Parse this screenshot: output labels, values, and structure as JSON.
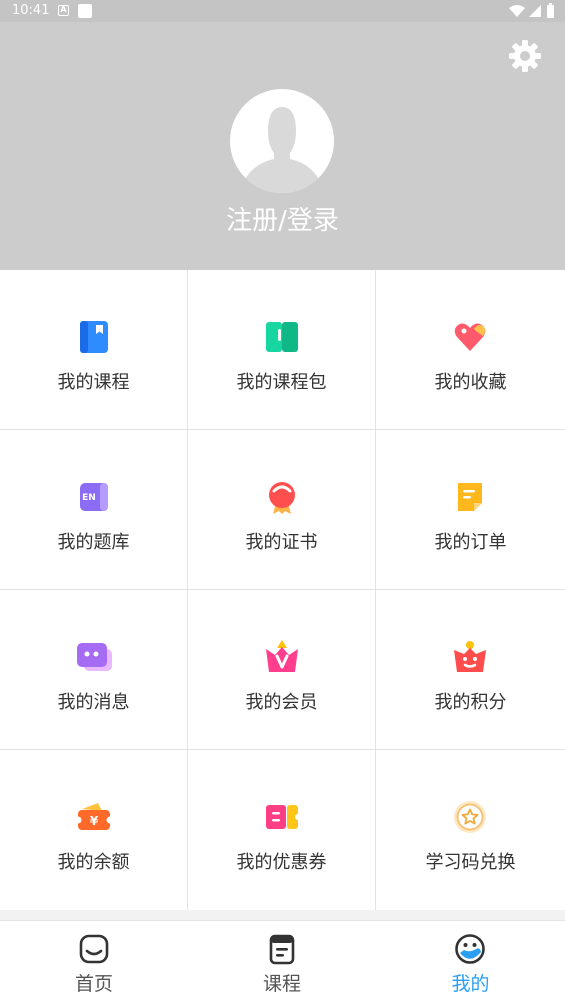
{
  "status_bar": {
    "time": "10:41"
  },
  "profile": {
    "login_label": "注册/登录"
  },
  "menu": [
    {
      "label": "我的课程",
      "icon": "course-book-icon"
    },
    {
      "label": "我的课程包",
      "icon": "course-package-icon"
    },
    {
      "label": "我的收藏",
      "icon": "heart-tag-icon"
    },
    {
      "label": "我的题库",
      "icon": "question-bank-icon"
    },
    {
      "label": "我的证书",
      "icon": "certificate-medal-icon"
    },
    {
      "label": "我的订单",
      "icon": "order-note-icon"
    },
    {
      "label": "我的消息",
      "icon": "message-bubble-icon"
    },
    {
      "label": "我的会员",
      "icon": "vip-crown-icon"
    },
    {
      "label": "我的积分",
      "icon": "points-gift-icon"
    },
    {
      "label": "我的余额",
      "icon": "balance-wallet-icon"
    },
    {
      "label": "我的优惠券",
      "icon": "coupon-ticket-icon"
    },
    {
      "label": "学习码兑换",
      "icon": "redeem-star-icon"
    }
  ],
  "tabs": [
    {
      "label": "首页",
      "icon": "home-icon"
    },
    {
      "label": "课程",
      "icon": "course-list-icon"
    },
    {
      "label": "我的",
      "icon": "profile-face-icon",
      "active": true
    }
  ],
  "colors": {
    "header_bg": "#cccccc",
    "accent": "#2a9ff1"
  }
}
